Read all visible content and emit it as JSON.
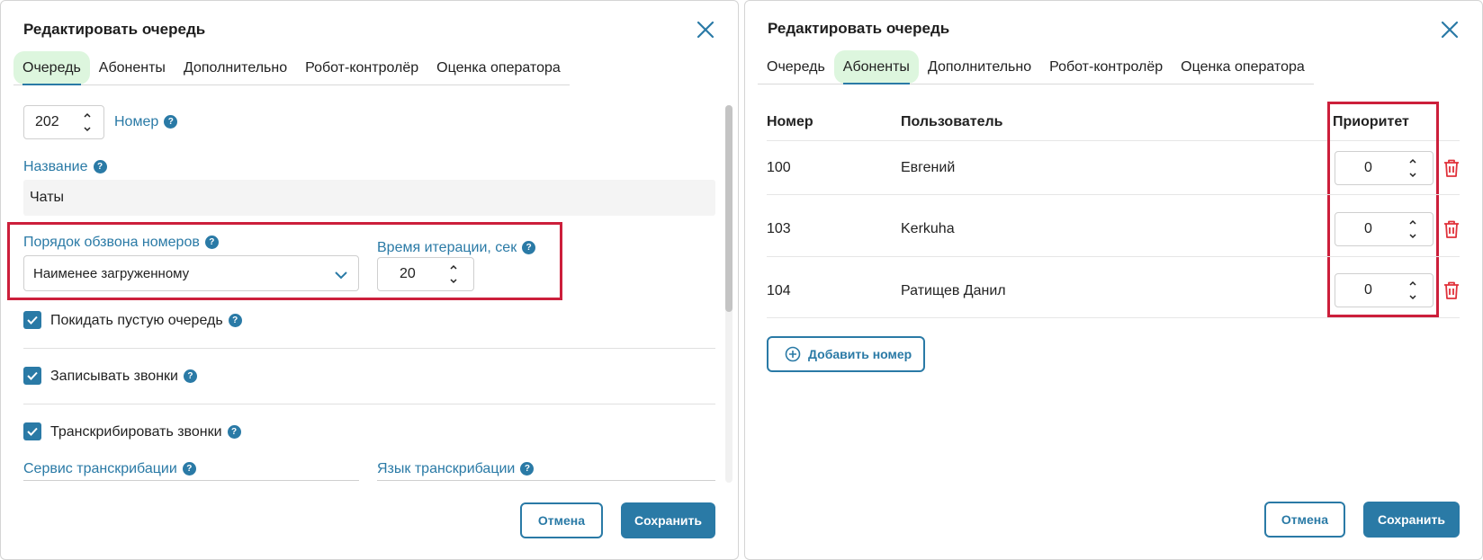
{
  "left_dialog": {
    "title": "Редактировать очередь",
    "tabs": [
      {
        "label": "Очередь",
        "active": true
      },
      {
        "label": "Абоненты",
        "active": false
      },
      {
        "label": "Дополнительно",
        "active": false
      },
      {
        "label": "Робот-контролёр",
        "active": false
      },
      {
        "label": "Оценка оператора",
        "active": false
      }
    ],
    "number": {
      "value": "202",
      "label": "Номер"
    },
    "name": {
      "label": "Название",
      "value": "Чаты"
    },
    "dial_order": {
      "label": "Порядок обзвона номеров",
      "value": "Наименее загруженному"
    },
    "iteration": {
      "label": "Время итерации, сек",
      "value": "20"
    },
    "checkboxes": [
      {
        "label": "Покидать пустую очередь",
        "checked": true
      },
      {
        "label": "Записывать звонки",
        "checked": true
      },
      {
        "label": "Транскрибировать звонки",
        "checked": true
      }
    ],
    "transcription_service_label": "Сервис транскрибации",
    "transcription_language_label": "Язык транскрибации",
    "cancel_label": "Отмена",
    "save_label": "Сохранить"
  },
  "right_dialog": {
    "title": "Редактировать очередь",
    "tabs": [
      {
        "label": "Очередь",
        "active": false
      },
      {
        "label": "Абоненты",
        "active": true
      },
      {
        "label": "Дополнительно",
        "active": false
      },
      {
        "label": "Робот-контролёр",
        "active": false
      },
      {
        "label": "Оценка оператора",
        "active": false
      }
    ],
    "table": {
      "headers": {
        "number": "Номер",
        "user": "Пользователь",
        "priority": "Приоритет"
      },
      "rows": [
        {
          "number": "100",
          "user": "Евгений",
          "priority": "0"
        },
        {
          "number": "103",
          "user": "Kerkuha",
          "priority": "0"
        },
        {
          "number": "104",
          "user": "Ратищев Данил",
          "priority": "0"
        }
      ]
    },
    "add_number_label": "Добавить номер",
    "cancel_label": "Отмена",
    "save_label": "Сохранить"
  },
  "help_glyph": "?",
  "colors": {
    "accent": "#2a7aa6",
    "highlight": "#cc1f3b",
    "active_tab_bg": "#ddf6de",
    "delete": "#e0313a"
  }
}
